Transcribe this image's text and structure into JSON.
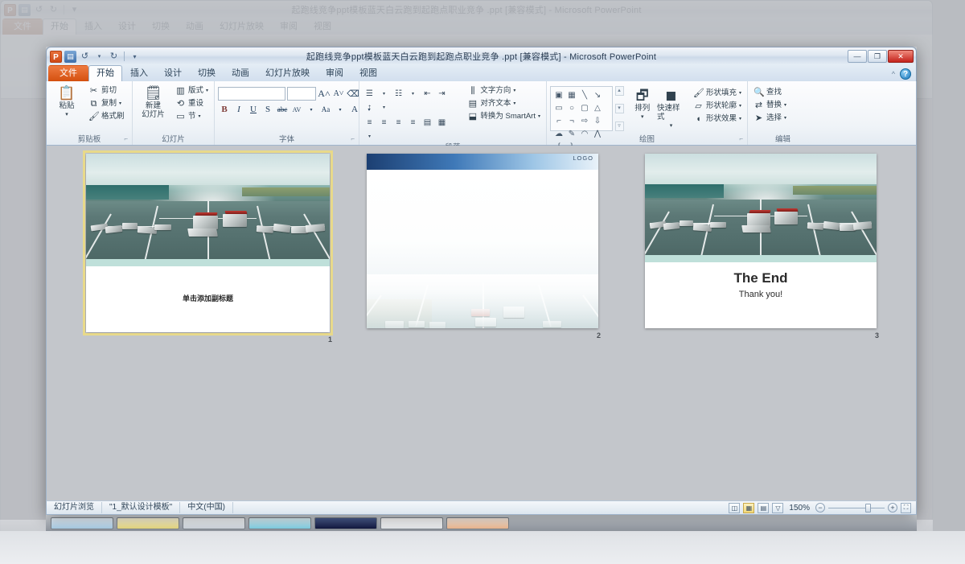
{
  "app": {
    "name": "Microsoft PowerPoint",
    "window_title": "起跑线竞争ppt模板蓝天白云跑到起跑点职业竞争 .ppt [兼容模式] - Microsoft PowerPoint",
    "logo_letter": "P"
  },
  "quick_access": {
    "save": "save-icon",
    "undo": "undo-icon",
    "redo": "redo-icon",
    "customize": "customize-icon"
  },
  "window_buttons": {
    "minimize": "—",
    "restore": "❐",
    "close": "✕",
    "collapse_ribbon": "^",
    "help": "?"
  },
  "tabs": [
    {
      "label": "文件",
      "type": "file"
    },
    {
      "label": "开始",
      "type": "active"
    },
    {
      "label": "插入",
      "type": "normal"
    },
    {
      "label": "设计",
      "type": "normal"
    },
    {
      "label": "切换",
      "type": "normal"
    },
    {
      "label": "动画",
      "type": "normal"
    },
    {
      "label": "幻灯片放映",
      "type": "normal"
    },
    {
      "label": "审阅",
      "type": "normal"
    },
    {
      "label": "视图",
      "type": "normal"
    }
  ],
  "ribbon": {
    "clipboard": {
      "group_label": "剪贴板",
      "paste": "粘贴",
      "cut": "剪切",
      "copy": "复制",
      "format_painter": "格式刷",
      "dialog_launcher": "⌐"
    },
    "slides": {
      "group_label": "幻灯片",
      "new_slide": "新建\n幻灯片",
      "new_slide_l1": "新建",
      "new_slide_l2": "幻灯片",
      "layout": "版式",
      "reset": "重设",
      "section": "节"
    },
    "font": {
      "group_label": "字体",
      "font_name_value": "",
      "font_size_value": "",
      "grow_font": "A",
      "shrink_font": "A",
      "clear_formatting": "⌫",
      "bold": "B",
      "italic": "I",
      "underline": "U",
      "shadow": "S",
      "strikethrough": "abc",
      "character_spacing": "AV",
      "change_case": "Aa",
      "font_color": "A"
    },
    "paragraph": {
      "group_label": "段落",
      "text_direction": "文字方向",
      "align_text": "对齐文本",
      "convert_to_smartart": "转换为 SmartArt",
      "dialog_launcher": "⌐"
    },
    "drawing": {
      "group_label": "绘图",
      "arrange_l1": "排列",
      "quick_styles_l1": "快速样式",
      "shape_fill": "形状填充",
      "shape_outline": "形状轮廓",
      "shape_effects": "形状效果",
      "dialog_launcher": "⌐"
    },
    "editing": {
      "group_label": "编辑",
      "find": "查找",
      "replace": "替换",
      "select": "选择"
    }
  },
  "slides": [
    {
      "number": "1",
      "selected": true,
      "type": "title",
      "subtitle": "单击添加副标题"
    },
    {
      "number": "2",
      "selected": false,
      "type": "content",
      "logo": "LOGO"
    },
    {
      "number": "3",
      "selected": false,
      "type": "end",
      "title": "The End",
      "subtitle": "Thank you!"
    }
  ],
  "status_bar": {
    "view_name": "幻灯片浏览",
    "design_template": "\"1_默认设计模板\"",
    "language": "中文(中国)",
    "zoom_level": "150%",
    "zoom_out": "−",
    "zoom_in": "+",
    "fit_to_window": "⛶",
    "view_normal": "view-normal-icon",
    "view_sorter": "view-sorter-icon",
    "view_reading": "view-reading-icon",
    "view_slideshow": "view-slideshow-icon"
  },
  "colors": {
    "accent_orange": "#d4500f",
    "selection_gold": "#e8d98a",
    "close_red": "#c4221b",
    "workspace_gray": "#c3c6cb"
  }
}
